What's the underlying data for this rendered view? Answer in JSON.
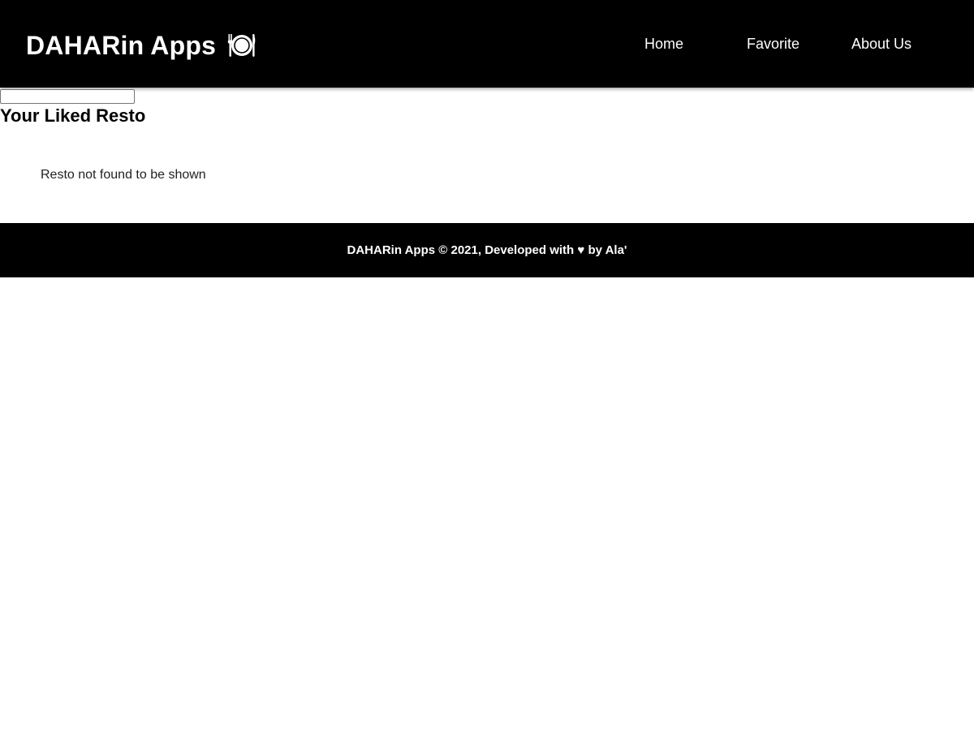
{
  "header": {
    "brand_name": "DAHARin Apps",
    "brand_icon": "plate-fork-knife-icon",
    "nav": [
      {
        "label": "Home"
      },
      {
        "label": "Favorite"
      },
      {
        "label": "About Us"
      }
    ]
  },
  "search": {
    "value": "",
    "placeholder": ""
  },
  "main": {
    "title": "Your Liked Resto",
    "empty_message": "Resto not found to be shown"
  },
  "footer": {
    "text": "DAHARin Apps © 2021, Developed with ♥ by Ala'"
  },
  "colors": {
    "header_bg": "#000000",
    "footer_bg": "#000000",
    "page_bg": "#ffffff",
    "header_text": "#ffffff"
  }
}
